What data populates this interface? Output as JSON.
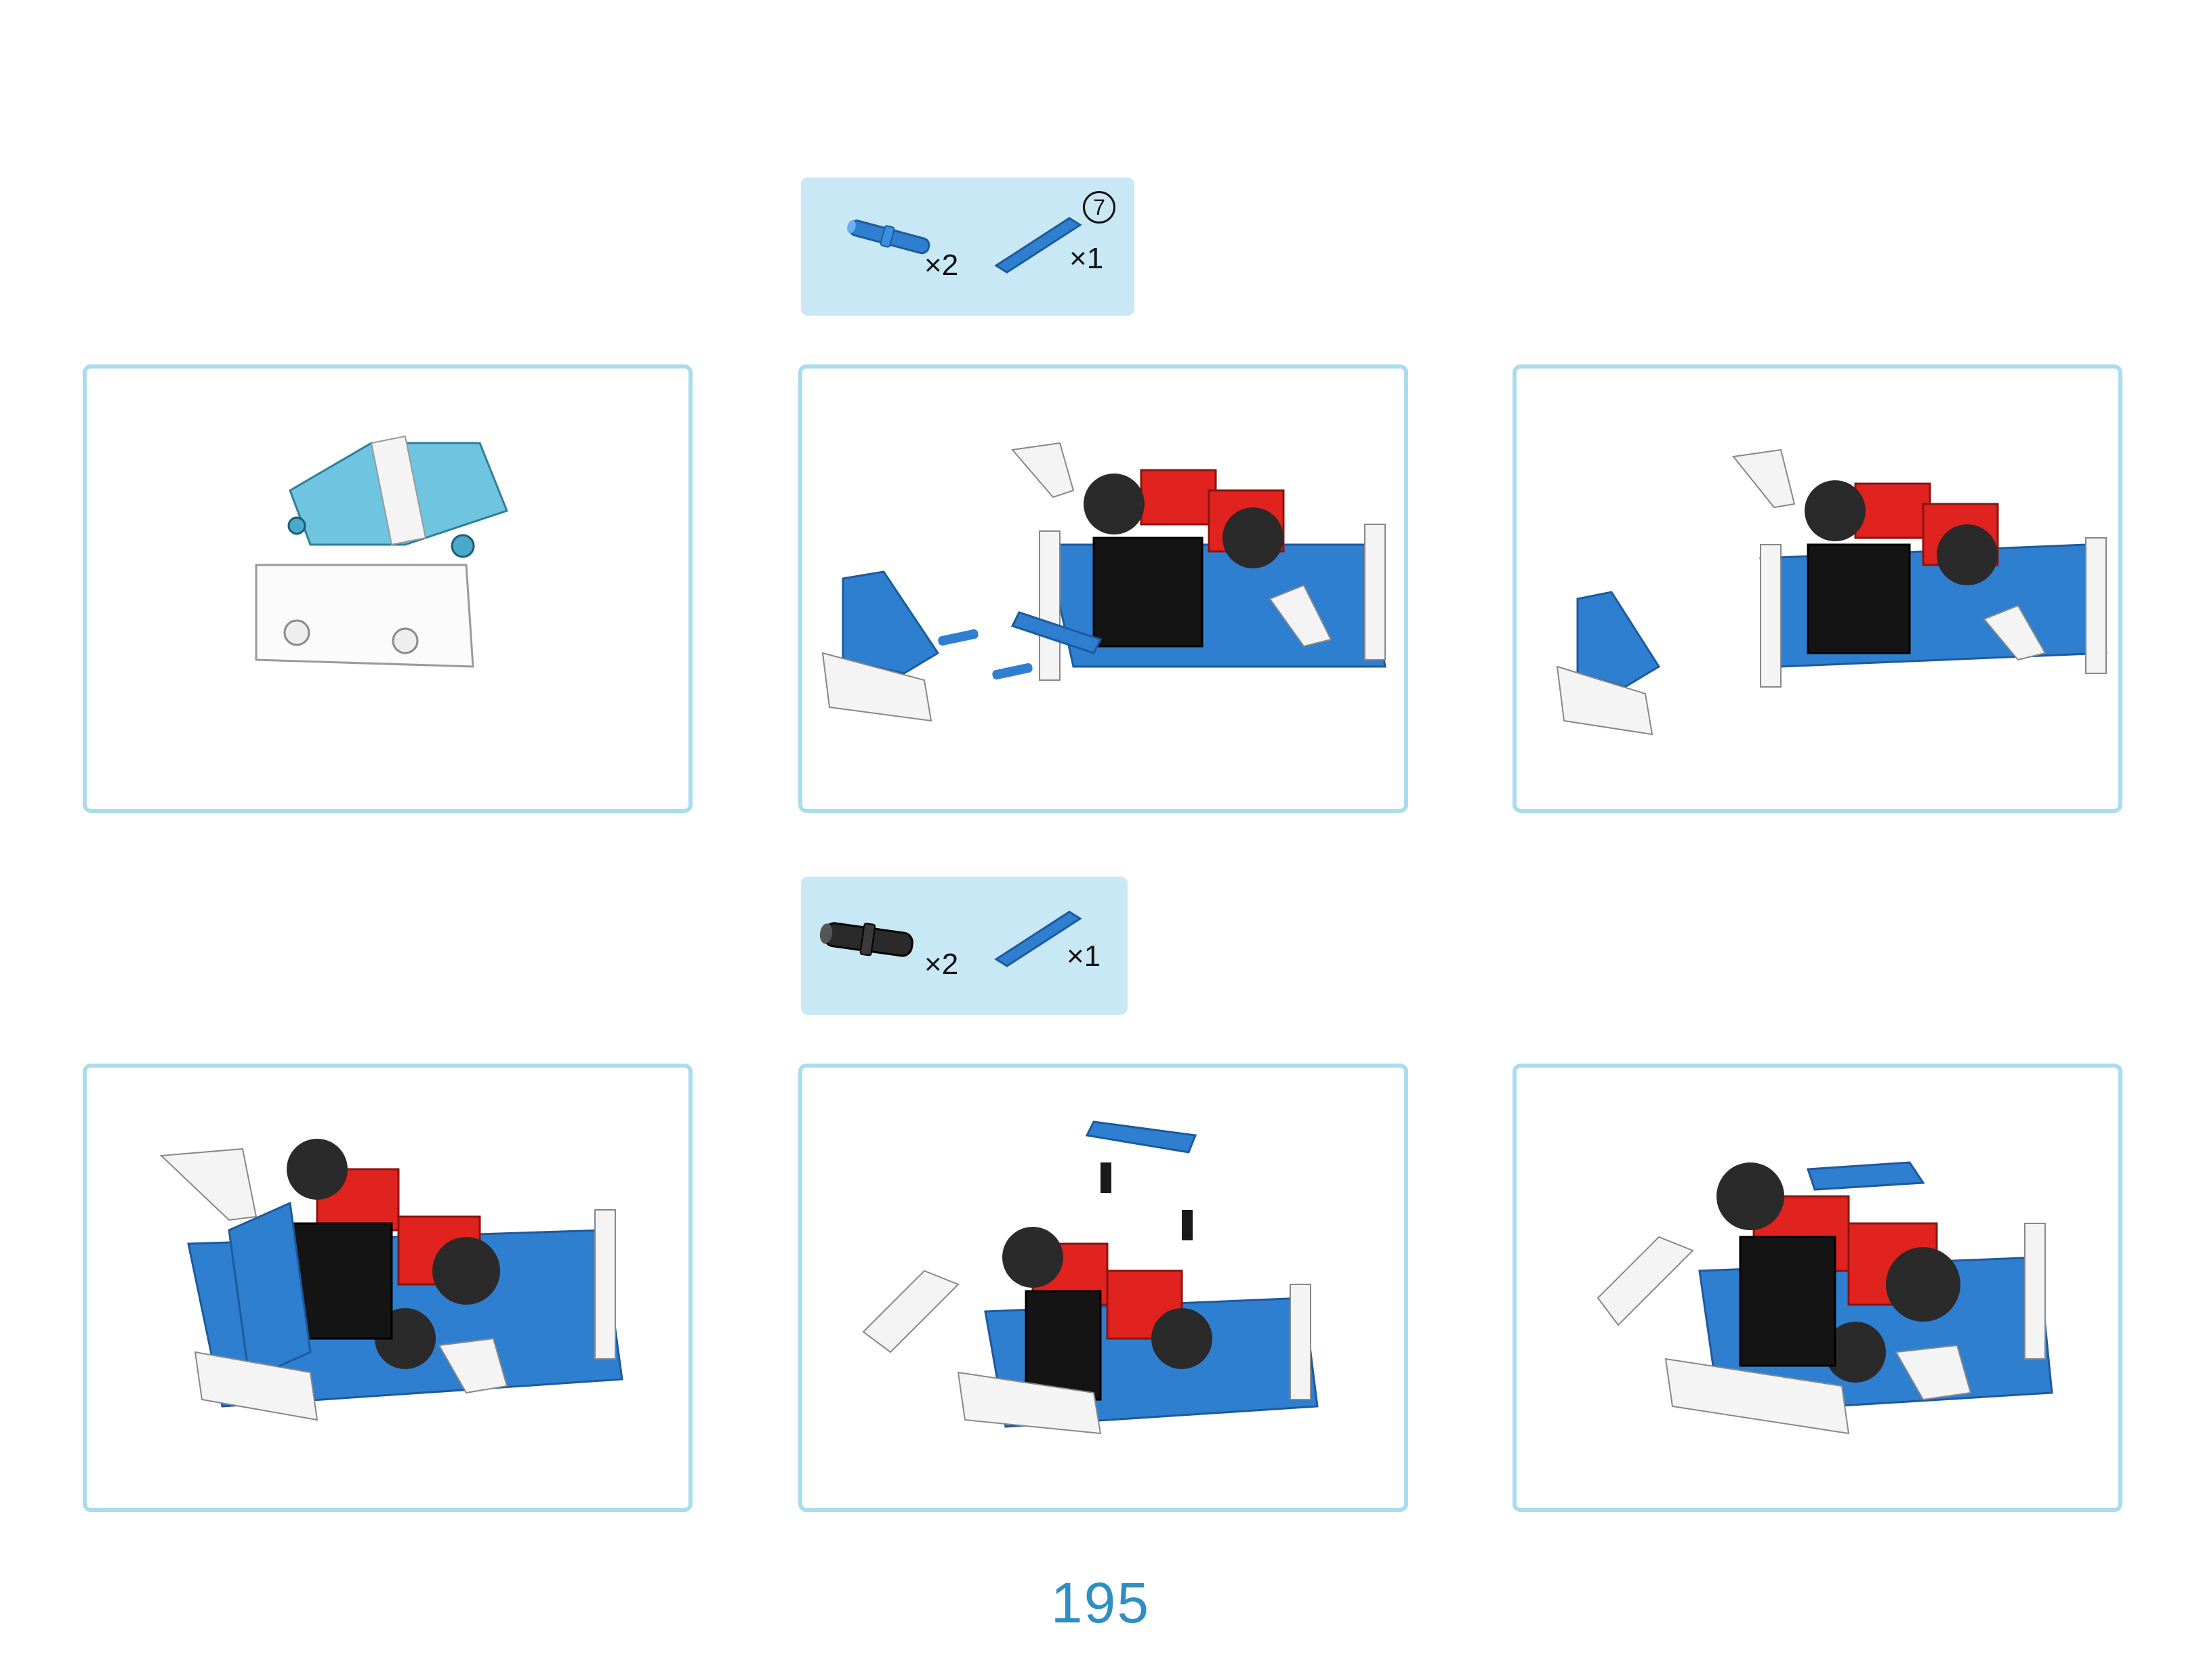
{
  "parts_lists": [
    {
      "items": [
        {
          "name": "blue-axle-pin",
          "count": "×2"
        },
        {
          "name": "blue-beam",
          "count": "×1"
        }
      ],
      "step_badge": "7"
    },
    {
      "items": [
        {
          "name": "black-friction-pin",
          "count": "×2"
        },
        {
          "name": "blue-beam",
          "count": "×1"
        }
      ]
    }
  ],
  "panels": [
    {
      "name": "step-claw-front-part"
    },
    {
      "name": "step-attach-claw-exploded"
    },
    {
      "name": "step-claw-attached"
    },
    {
      "name": "step-robot-with-claw"
    },
    {
      "name": "step-top-beam-exploded"
    },
    {
      "name": "step-robot-complete"
    }
  ],
  "colors": {
    "panel_border": "#a9dced",
    "parts_box_bg": "#c9e8f5",
    "page_number": "#2f8fc4",
    "part_blue": "#2f7fd0",
    "part_red": "#e0231e",
    "part_black": "#1a1a1a",
    "part_white": "#f4f4f4",
    "part_light_blue": "#6fc5df"
  },
  "page_number": "195"
}
